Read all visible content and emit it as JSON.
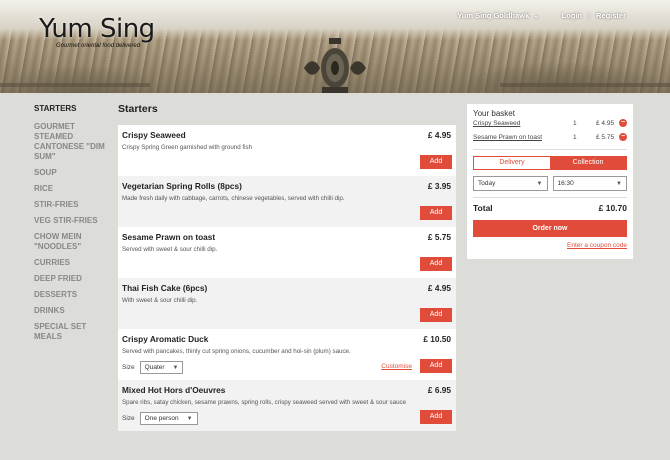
{
  "header": {
    "logo_title": "Yum Sing",
    "logo_subtitle": "Gourmet oriental food delivered",
    "branch": "Yum Sing Goldhawk",
    "login": "Login",
    "separator": "|",
    "register": "Register"
  },
  "nav": {
    "items": [
      {
        "label": "STARTERS",
        "active": true
      },
      {
        "label": "GOURMET STEAMED CANTONESE \"DIM SUM\""
      },
      {
        "label": "SOUP"
      },
      {
        "label": "RICE"
      },
      {
        "label": "STIR-FRIES"
      },
      {
        "label": "VEG STIR-FRIES"
      },
      {
        "label": "CHOW MEIN \"NOODLES\""
      },
      {
        "label": "CURRIES"
      },
      {
        "label": "DEEP FRIED"
      },
      {
        "label": "DESSERTS"
      },
      {
        "label": "DRINKS"
      },
      {
        "label": "SPECIAL SET MEALS"
      }
    ]
  },
  "main": {
    "section_title": "Starters",
    "add_label": "Add",
    "size_label": "Size",
    "customise_label": "Customise",
    "items": [
      {
        "name": "Crispy Seaweed",
        "desc": "Crispy Spring Green garnished with ground fish",
        "price": "£ 4.95"
      },
      {
        "name": "Vegetarian Spring Rolls (8pcs)",
        "desc": "Made fresh daily with cabbage, carrots, chinese vegetables, served with chilli dip.",
        "price": "£ 3.95"
      },
      {
        "name": "Sesame Prawn on toast",
        "desc": "Served with sweet & sour chilli dip.",
        "price": "£ 5.75"
      },
      {
        "name": "Thai Fish Cake (6pcs)",
        "desc": "With sweet & sour chilli dip.",
        "price": "£ 4.95"
      },
      {
        "name": "Crispy Aromatic Duck",
        "desc": "Served with pancakes, thinly cut spring onions, cucumber and hoi-sin (plum) sauce.",
        "price": "£ 10.50",
        "size": "Quater"
      },
      {
        "name": "Mixed Hot Hors d'Oeuvres",
        "desc": "Spare ribs, satay chicken, sesame prawns, spring rolls, crispy seaweed served with sweet & sour sauce",
        "price": "£ 6.95",
        "size": "One person"
      }
    ]
  },
  "basket": {
    "title": "Your basket",
    "lines": [
      {
        "name": "Crispy Seaweed",
        "qty": "1",
        "price": "£ 4.95"
      },
      {
        "name": "Sesame Prawn on toast",
        "qty": "1",
        "price": "£ 5.75"
      }
    ],
    "delivery_label": "Delivery",
    "collection_label": "Collection",
    "day": "Today",
    "time": "16:30",
    "total_label": "Total",
    "total_value": "£ 10.70",
    "order_label": "Order now",
    "coupon_label": "Enter a coupon code"
  },
  "colors": {
    "accent": "#e04b3a"
  }
}
